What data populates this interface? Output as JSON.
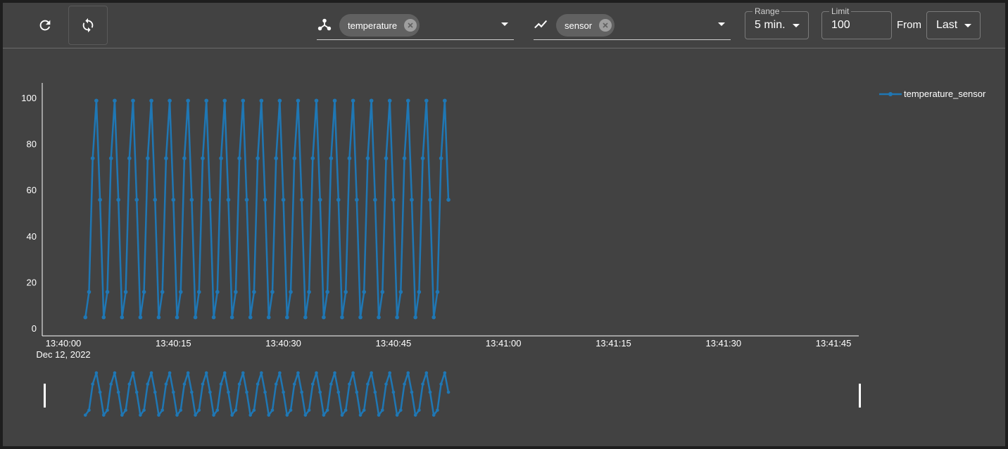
{
  "toolbar": {
    "refresh_icon": "refresh-icon",
    "auto_refresh_icon": "sync-icon",
    "measurement_select": {
      "icon": "hub-icon",
      "chip": "temperature"
    },
    "field_select": {
      "icon": "line-chart-icon",
      "chip": "sensor"
    },
    "range": {
      "label": "Range",
      "value": "5 min."
    },
    "limit": {
      "label": "Limit",
      "value": "100"
    },
    "from": {
      "label": "From",
      "value": "Last"
    }
  },
  "colors": {
    "series": "#1f77b4",
    "background": "#424242"
  },
  "chart_data": {
    "type": "line",
    "legend_position": "top-right",
    "grid": false,
    "x_unit": "seconds after 13:40:00",
    "xlim": [
      0,
      45
    ],
    "ylim": [
      0,
      100
    ],
    "x_tick_labels": [
      "13:40:00",
      "13:40:15",
      "13:40:30",
      "13:40:45",
      "13:41:00",
      "13:41:15",
      "13:41:30",
      "13:41:45"
    ],
    "x_date_label": "Dec 12, 2022",
    "y_ticks": [
      0,
      20,
      40,
      60,
      80,
      100
    ],
    "series": [
      {
        "name": "temperature_sensor",
        "cycle_values": [
          5,
          16,
          74,
          99,
          56
        ],
        "cycles": 20,
        "cycle_period_s": 2.5,
        "point_spacing_s": 0.5,
        "final_values": [
          5,
          16,
          74,
          99,
          56
        ],
        "start_offset_s": 3
      }
    ]
  }
}
